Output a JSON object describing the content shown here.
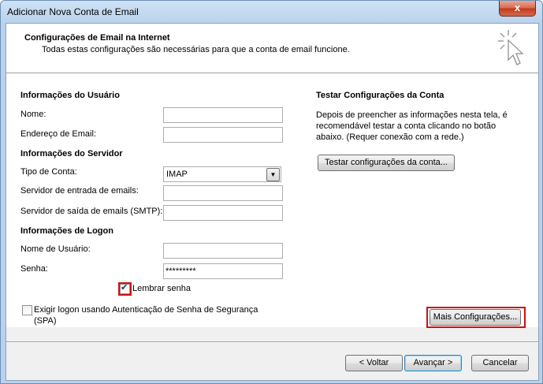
{
  "window": {
    "title": "Adicionar Nova Conta de Email",
    "close_label": "x"
  },
  "header": {
    "title": "Configurações de Email na Internet",
    "subtitle": "Todas estas configurações são necessárias para que a conta de email funcione."
  },
  "user_info": {
    "heading": "Informações do Usuário",
    "name_label": "Nome:",
    "name_value": "",
    "email_label": "Endereço de Email:",
    "email_value": ""
  },
  "server_info": {
    "heading": "Informações do Servidor",
    "account_type_label": "Tipo de Conta:",
    "account_type_value": "IMAP",
    "incoming_label": "Servidor de entrada de emails:",
    "incoming_value": "",
    "outgoing_label": "Servidor de saída de emails (SMTP):",
    "outgoing_value": ""
  },
  "logon_info": {
    "heading": "Informações de Logon",
    "username_label": "Nome de Usuário:",
    "username_value": "",
    "password_label": "Senha:",
    "password_value": "*********",
    "remember_label": "Lembrar senha",
    "remember_checked": true
  },
  "spa": {
    "label": "Exigir logon usando Autenticação de Senha de Segurança (SPA)",
    "checked": false
  },
  "test_settings": {
    "heading": "Testar Configurações da Conta",
    "description": "Depois de preencher as informações nesta tela, é recomendável testar a conta clicando no botão abaixo. (Requer conexão com a rede.)",
    "test_button": "Testar configurações da conta..."
  },
  "more_settings_button": "Mais Configurações...",
  "footer": {
    "back_label": "< Voltar",
    "next_label": "Avançar >",
    "cancel_label": "Cancelar"
  },
  "colors": {
    "highlight": "#d01010",
    "title_bar": "#b9d1ea"
  }
}
